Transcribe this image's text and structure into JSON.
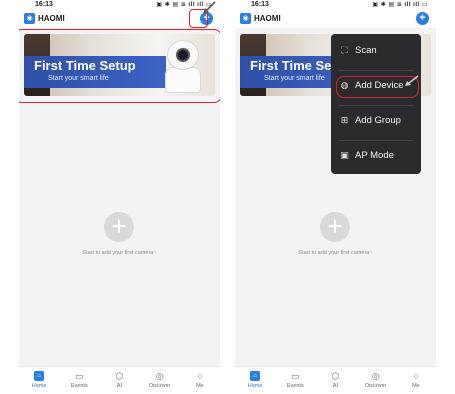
{
  "status": {
    "time": "16:13",
    "icons": "▣ ✱ ▤ ≋ ıll ıll ▭"
  },
  "app": {
    "name": "HAOMI",
    "logo_icon": "camera-app-icon",
    "add_icon": "plus-icon"
  },
  "banner": {
    "title": "First Time Setup",
    "subtitle": "Start your smart life"
  },
  "empty": {
    "hint": "Start to add your first camera~"
  },
  "tabs": [
    {
      "label": "Home",
      "icon": "home-icon"
    },
    {
      "label": "Events",
      "icon": "events-icon"
    },
    {
      "label": "AI",
      "icon": "ai-icon"
    },
    {
      "label": "Discover",
      "icon": "discover-icon"
    },
    {
      "label": "Me",
      "icon": "me-icon"
    }
  ],
  "menu": {
    "items": [
      {
        "label": "Scan",
        "icon": "scan-icon"
      },
      {
        "label": "Add Device",
        "icon": "add-device-icon"
      },
      {
        "label": "Add Group",
        "icon": "add-group-icon"
      },
      {
        "label": "AP Mode",
        "icon": "ap-mode-icon"
      }
    ]
  },
  "colors": {
    "accent": "#2a7de1",
    "highlight": "#d9232f",
    "menu_bg": "#2b2b2d"
  }
}
